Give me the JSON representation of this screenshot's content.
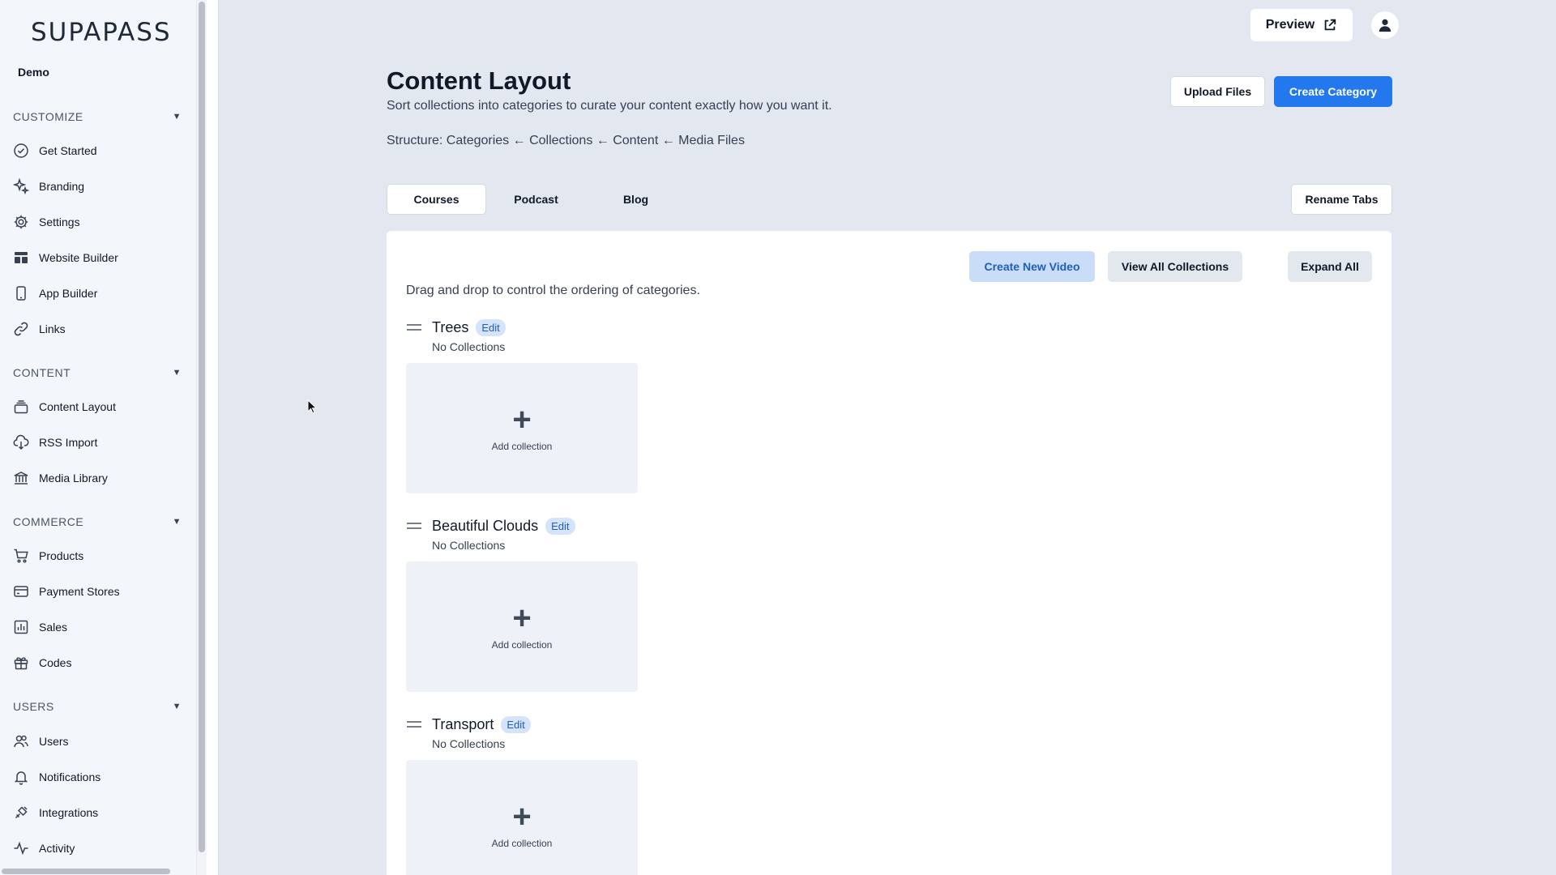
{
  "app": {
    "logo": "SUPAPASS",
    "org": "Demo"
  },
  "sidebar": {
    "sections": [
      {
        "title": "CUSTOMIZE",
        "items": [
          {
            "label": "Get Started",
            "icon": "check-circle-icon"
          },
          {
            "label": "Branding",
            "icon": "sparkles-icon"
          },
          {
            "label": "Settings",
            "icon": "gear-icon"
          },
          {
            "label": "Website Builder",
            "icon": "layout-icon"
          },
          {
            "label": "App Builder",
            "icon": "phone-icon"
          },
          {
            "label": "Links",
            "icon": "link-icon"
          }
        ]
      },
      {
        "title": "CONTENT",
        "items": [
          {
            "label": "Content Layout",
            "icon": "layers-icon"
          },
          {
            "label": "RSS Import",
            "icon": "cloud-download-icon"
          },
          {
            "label": "Media Library",
            "icon": "library-icon"
          }
        ]
      },
      {
        "title": "COMMERCE",
        "items": [
          {
            "label": "Products",
            "icon": "cart-icon"
          },
          {
            "label": "Payment Stores",
            "icon": "credit-card-icon"
          },
          {
            "label": "Sales",
            "icon": "bar-chart-icon"
          },
          {
            "label": "Codes",
            "icon": "gift-icon"
          }
        ]
      },
      {
        "title": "USERS",
        "items": [
          {
            "label": "Users",
            "icon": "users-icon"
          },
          {
            "label": "Notifications",
            "icon": "bell-icon"
          },
          {
            "label": "Integrations",
            "icon": "plug-icon"
          },
          {
            "label": "Activity",
            "icon": "activity-icon"
          }
        ]
      }
    ]
  },
  "header": {
    "preview_label": "Preview",
    "title": "Content Layout",
    "subtitle": "Sort collections into categories to curate your content exactly how you want it.",
    "structure": "Structure: Categories ← Collections ← Content ← Media Files",
    "upload_label": "Upload Files",
    "create_category_label": "Create Category"
  },
  "tabs": [
    {
      "label": "Courses",
      "active": true
    },
    {
      "label": "Podcast",
      "active": false
    },
    {
      "label": "Blog",
      "active": false
    }
  ],
  "rename_tabs_label": "Rename Tabs",
  "panel": {
    "create_video_label": "Create New Video",
    "view_collections_label": "View All Collections",
    "expand_all_label": "Expand All",
    "drag_note": "Drag and drop to control the ordering of categories.",
    "edit_label": "Edit",
    "add_collection_label": "Add collection",
    "categories": [
      {
        "name": "Trees",
        "count_text": "No Collections"
      },
      {
        "name": "Beautiful Clouds",
        "count_text": "No Collections"
      },
      {
        "name": "Transport",
        "count_text": "No Collections"
      }
    ]
  },
  "colors": {
    "accent": "#2478ee",
    "background": "#e2e7f0",
    "sidebar": "#f3f6fb",
    "badge": "#d5e4fa"
  }
}
